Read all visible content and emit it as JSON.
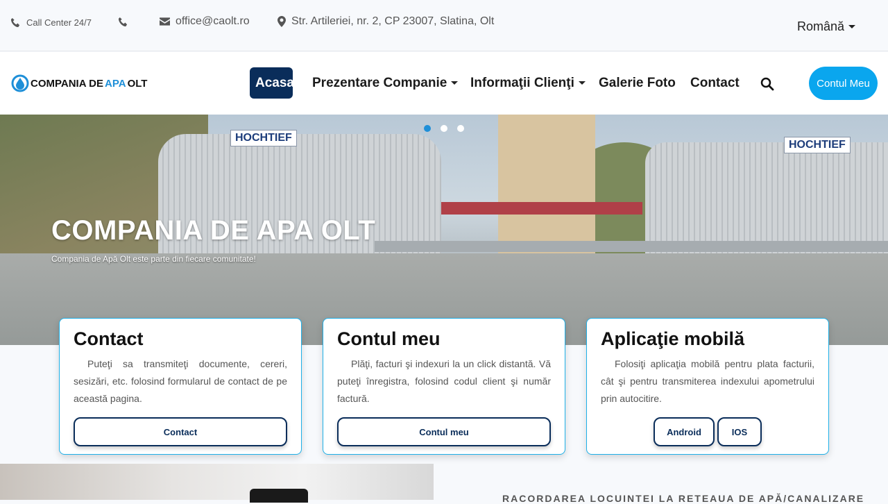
{
  "topbar": {
    "call_center": "Call Center 24/7",
    "email": "office@caolt.ro",
    "address": "Str. Artileriei, nr. 2, CP 23007, Slatina, Olt",
    "language": "Română"
  },
  "navbar": {
    "logo_part1": "COMPANIA DE ",
    "logo_part2": "APA",
    "logo_part3": " OLT",
    "items": [
      {
        "label": "Acasa"
      },
      {
        "label": "Prezentare Companie"
      },
      {
        "label": "Informaţii Clienţi"
      },
      {
        "label": "Galerie Foto"
      },
      {
        "label": "Contact"
      }
    ],
    "account_button": "Contul Meu"
  },
  "hero": {
    "title": "COMPANIA DE APA OLT",
    "subtitle": "Compania de Apă Olt este parte din fiecare comunitate!",
    "sign_text": "HOCHTIEF",
    "slide_count": 3,
    "active_slide": 1
  },
  "cards": [
    {
      "title": "Contact",
      "text": "Puteţi sa transmiteţi documente, cereri, sesizări, etc. folosind formularul de contact de pe această pagina.",
      "buttons": [
        "Contact"
      ]
    },
    {
      "title": "Contul meu",
      "text": "Plăţi, facturi şi indexuri la un click distantă. Vă puteţi înregistra, folosind codul client şi număr factură.",
      "buttons": [
        "Contul meu"
      ]
    },
    {
      "title": "Aplicaţie mobilă",
      "text": "Folosiţi aplicaţia mobilă pentru plata facturii, cât şi pentru transmiterea indexului apometrului prin autocitire.",
      "buttons": [
        "Android",
        "IOS"
      ]
    }
  ],
  "bottom": {
    "heading": "RACORDAREA LOCUINTEI LA RETEAUA DE APĂ/CANALIZARE"
  },
  "colors": {
    "primary_dark": "#0a2d5a",
    "accent_blue": "#0aa6ee",
    "card_border": "#1eb0e8"
  }
}
